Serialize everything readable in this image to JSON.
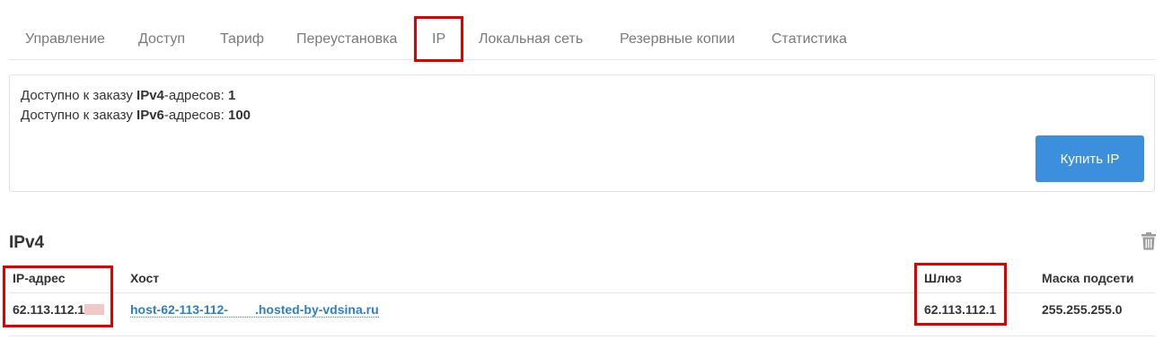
{
  "tabs": [
    {
      "label": "Управление"
    },
    {
      "label": "Доступ"
    },
    {
      "label": "Тариф"
    },
    {
      "label": "Переустановка"
    },
    {
      "label": "IP",
      "active": true
    },
    {
      "label": "Локальная сеть"
    },
    {
      "label": "Резервные копии"
    },
    {
      "label": "Статистика"
    }
  ],
  "availability": {
    "ipv4": {
      "prefix": "Доступно к заказу ",
      "type": "IPv4",
      "suffix": "-адресов: ",
      "count": "1"
    },
    "ipv6": {
      "prefix": "Доступно к заказу ",
      "type": "IPv6",
      "suffix": "-адресов: ",
      "count": "100"
    }
  },
  "buy_button_label": "Купить IP",
  "section": {
    "title": "IPv4",
    "delete_icon": "trash-icon"
  },
  "table": {
    "headers": {
      "ip": "IP-адрес",
      "host": "Хост",
      "gateway": "Шлюз",
      "mask": "Маска подсети"
    },
    "rows": [
      {
        "ip": "62.113.112.1",
        "host_start": "host-62-113-112-",
        "host_end": ".hosted-by-vdsina.ru",
        "gateway": "62.113.112.1",
        "mask": "255.255.255.0"
      }
    ]
  },
  "highlight_color": "#e00000",
  "accent_color": "#3b8fdc"
}
